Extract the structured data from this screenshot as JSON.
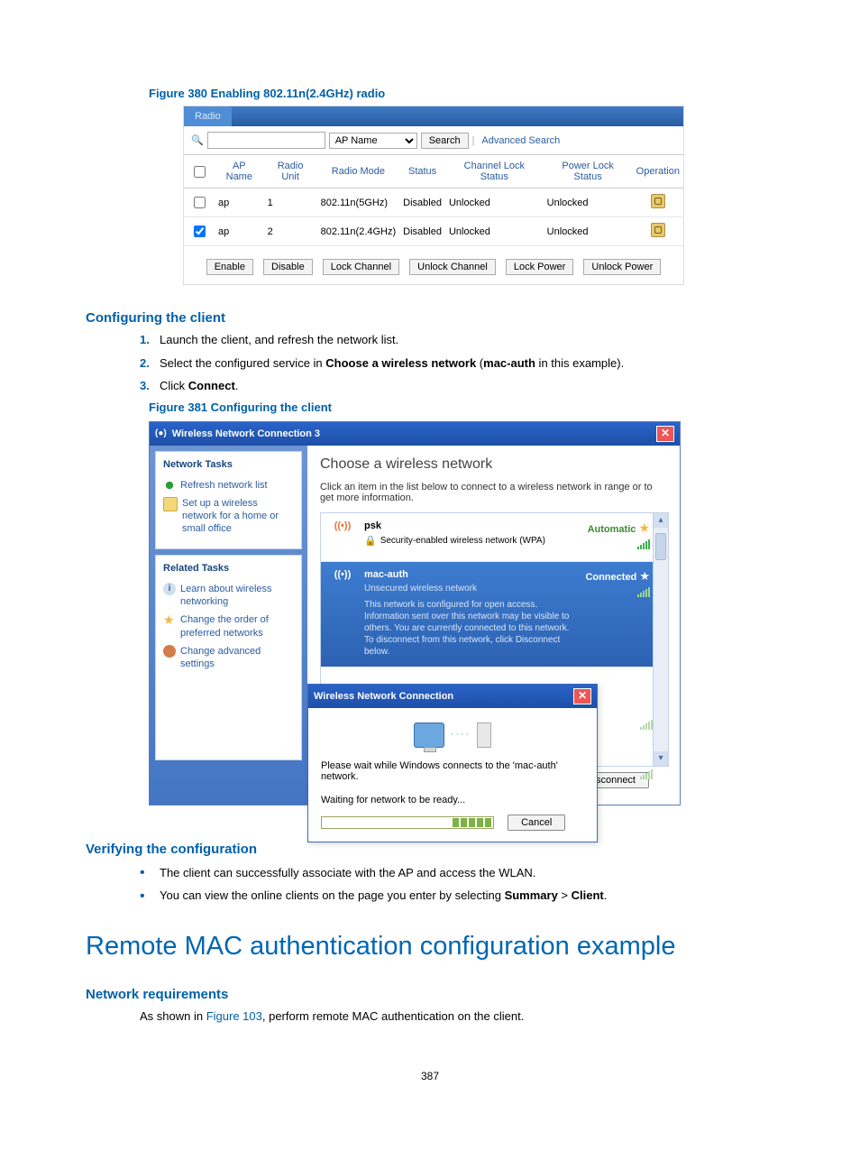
{
  "fig380": {
    "caption": "Figure 380 Enabling 802.11n(2.4GHz) radio",
    "tab": "Radio",
    "search_placeholder": "",
    "select_label": "AP Name",
    "search_btn": "Search",
    "adv_search": "Advanced Search",
    "cols": {
      "apname": "AP Name",
      "radiounit": "Radio Unit",
      "radiomode": "Radio Mode",
      "status": "Status",
      "chlock": "Channel Lock Status",
      "pwrlock": "Power Lock Status",
      "op": "Operation"
    },
    "rows": [
      {
        "checked": false,
        "apname": "ap",
        "unit": "1",
        "mode": "802.11n(5GHz)",
        "status": "Disabled",
        "ch": "Unlocked",
        "pwr": "Unlocked"
      },
      {
        "checked": true,
        "apname": "ap",
        "unit": "2",
        "mode": "802.11n(2.4GHz)",
        "status": "Disabled",
        "ch": "Unlocked",
        "pwr": "Unlocked"
      }
    ],
    "btns": {
      "enable": "Enable",
      "disable": "Disable",
      "lockch": "Lock Channel",
      "unlockch": "Unlock Channel",
      "lockpwr": "Lock Power",
      "unlockpwr": "Unlock Power"
    }
  },
  "sec_config_client": {
    "heading": "Configuring the client",
    "steps": {
      "s1": "Launch the client, and refresh the network list.",
      "s2a": "Select the configured service in ",
      "s2b": "Choose a wireless network",
      "s2c": " (",
      "s2d": "mac-auth",
      "s2e": " in this example).",
      "s3a": "Click ",
      "s3b": "Connect",
      "s3c": "."
    },
    "nums": {
      "n1": "1.",
      "n2": "2.",
      "n3": "3."
    }
  },
  "fig381": {
    "caption": "Figure 381 Configuring the client",
    "title": "Wireless Network Connection 3",
    "left": {
      "box1_title": "Network Tasks",
      "refresh": "Refresh network list",
      "setup": "Set up a wireless network for a home or small office",
      "box2_title": "Related Tasks",
      "learn": "Learn about wireless networking",
      "order": "Change the order of preferred networks",
      "adv": "Change advanced settings"
    },
    "right": {
      "choose": "Choose a wireless network",
      "instr": "Click an item in the list below to connect to a wireless network in range or to get more information.",
      "net1": {
        "name": "psk",
        "sub": "Security-enabled wireless network (WPA)",
        "status": "Automatic"
      },
      "net2": {
        "name": "mac-auth",
        "sub": "Unsecured wireless network",
        "status": "Connected",
        "desc": "This network is configured for open access. Information sent over this network may be visible to others. You are currently connected to this network. To disconnect from this network, click Disconnect below."
      },
      "disconnect": "Disconnect"
    },
    "inner": {
      "title": "Wireless Network Connection",
      "msg1": "Please wait while Windows connects to the 'mac-auth' network.",
      "msg2": "Waiting for network to be ready...",
      "cancel": "Cancel"
    }
  },
  "sec_verify": {
    "heading": "Verifying the configuration",
    "b1": "The client can successfully associate with the AP and access the WLAN.",
    "b2a": "You can view the online clients on the page you enter by selecting ",
    "b2b": "Summary",
    "b2c": " > ",
    "b2d": "Client",
    "b2e": "."
  },
  "h1": "Remote MAC authentication configuration example",
  "sec_req": {
    "heading": "Network requirements",
    "text_a": "As shown in ",
    "text_b": "Figure 103",
    "text_c": ", perform remote MAC authentication on the client."
  },
  "pagenum": "387",
  "info_i": "i",
  "star_glyph": "☆",
  "wave_glyph": "((•))",
  "close_glyph": "✕",
  "info_title_icon": "(●)"
}
